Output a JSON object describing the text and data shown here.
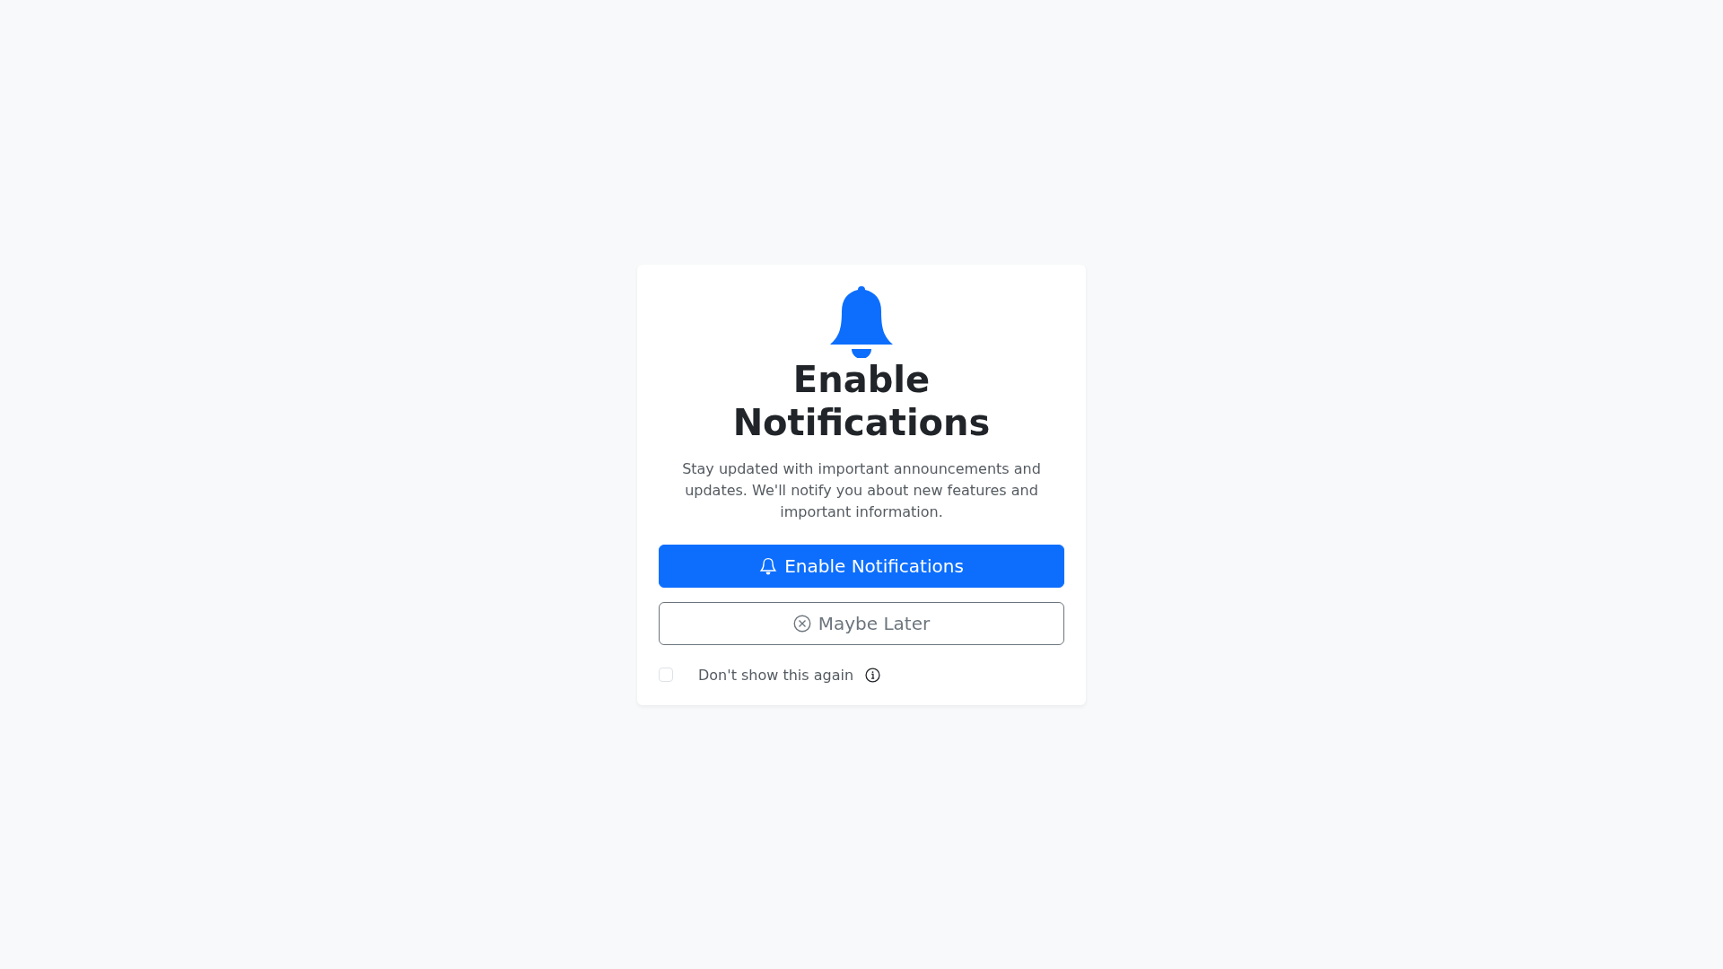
{
  "dialog": {
    "title": "Enable Notifications",
    "description": "Stay updated with important announcements and updates. We'll notify you about new features and important information.",
    "buttons": [
      {
        "kind": "primary",
        "label": "Enable Notifications"
      },
      {
        "kind": "secondary",
        "label": "Maybe Later"
      }
    ],
    "dont_show_again": {
      "label": "Don't show this again",
      "checked": false
    }
  }
}
